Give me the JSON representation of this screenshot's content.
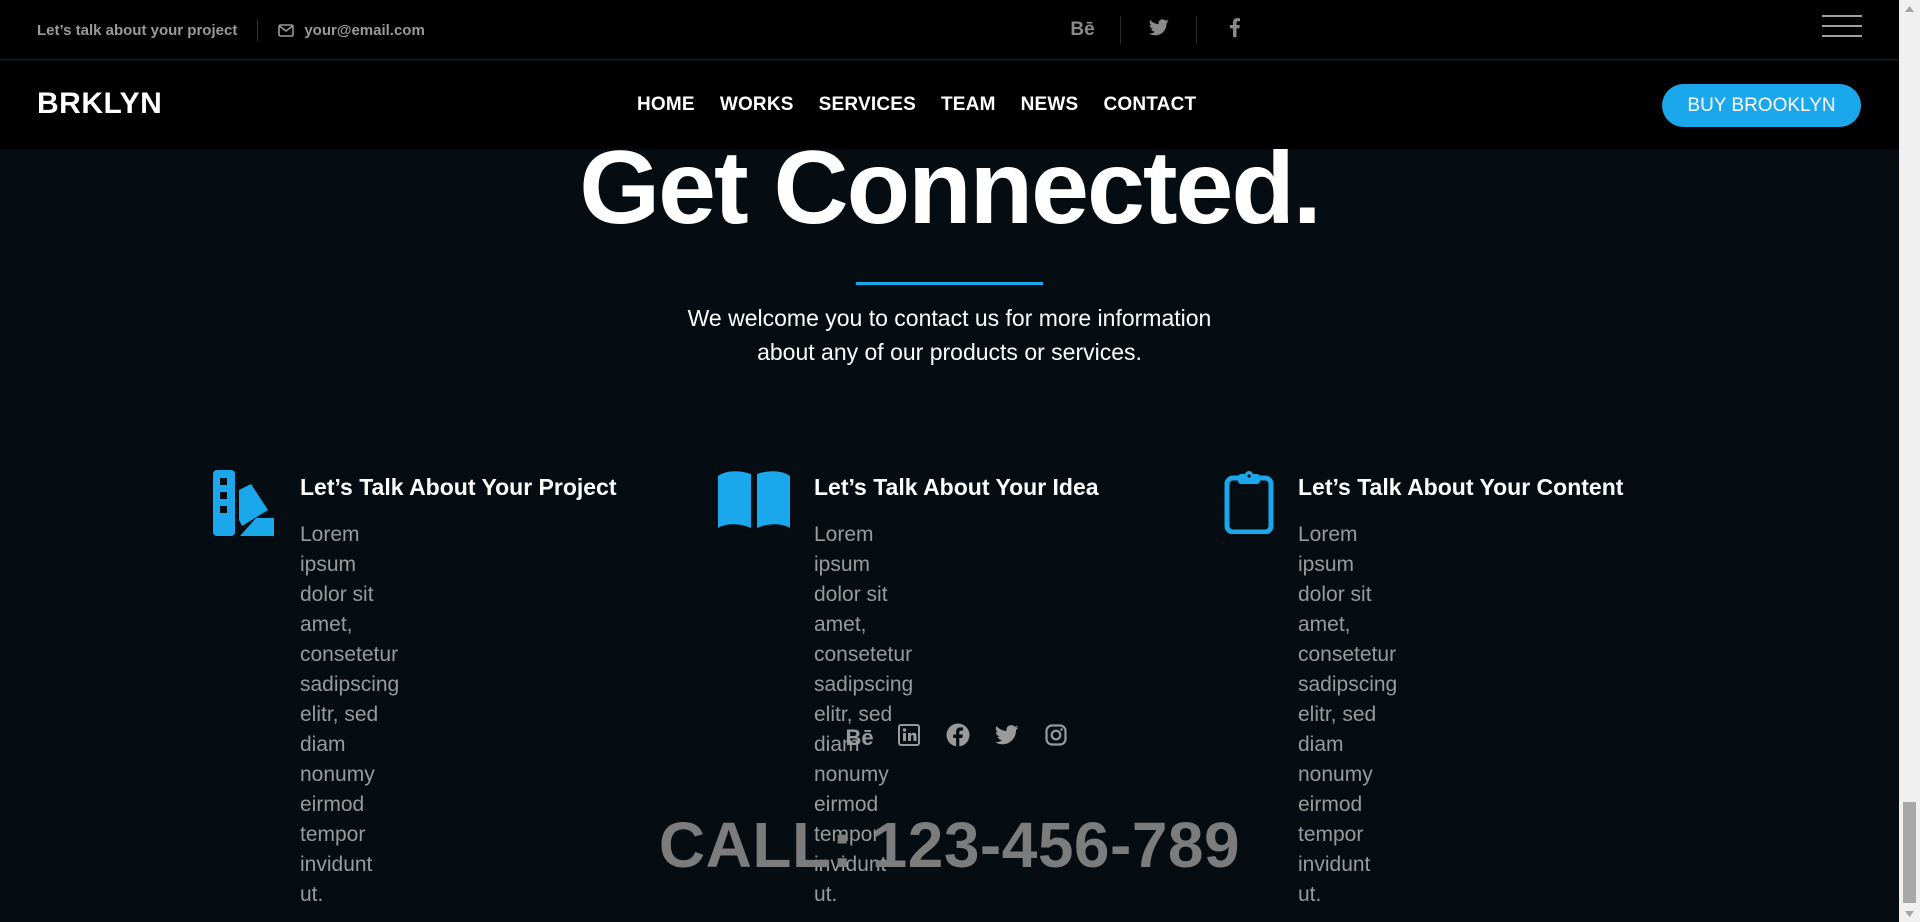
{
  "topbar": {
    "tagline": "Let’s talk about your project",
    "email": "your@email.com",
    "social": [
      {
        "name": "behance",
        "label": "Bē"
      },
      {
        "name": "twitter",
        "label": ""
      },
      {
        "name": "facebook",
        "label": ""
      }
    ]
  },
  "navbar": {
    "logo": "BRKLYN",
    "links": [
      "HOME",
      "WORKS",
      "SERVICES",
      "TEAM",
      "NEWS",
      "CONTACT"
    ],
    "cta": "BUY BROOKLYN"
  },
  "hero": {
    "title": "Get Connected.",
    "subtitle_line1": "We welcome you to contact us for more information",
    "subtitle_line2": "about any of our products or services."
  },
  "features": [
    {
      "icon": "swatchbook-icon",
      "title": "Let’s Talk About Your Project",
      "lines": [
        "Lorem ipsum dolor sit amet,",
        "consetetur sadipscing elitr, sed diam",
        "nonumy eirmod tempor invidunt ut."
      ]
    },
    {
      "icon": "book-open-icon",
      "title": "Let’s Talk About Your Idea",
      "lines": [
        "Lorem ipsum dolor sit amet,",
        "consetetur sadipscing elitr, sed",
        "diam nonumy eirmod tempor",
        "invidunt ut."
      ]
    },
    {
      "icon": "clipboard-icon",
      "title": "Let’s Talk About Your Content",
      "lines": [
        "Lorem ipsum dolor sit amet,",
        "consetetur sadipscing elitr, sed diam",
        "nonumy eirmod tempor invidunt ut."
      ]
    }
  ],
  "bottom_social": {
    "behance_label": "Bē"
  },
  "call": "CALL: 123-456-789",
  "colors": {
    "accent": "#1aa7ec",
    "background": "#050d12",
    "muted_text": "#9a9a9a"
  }
}
